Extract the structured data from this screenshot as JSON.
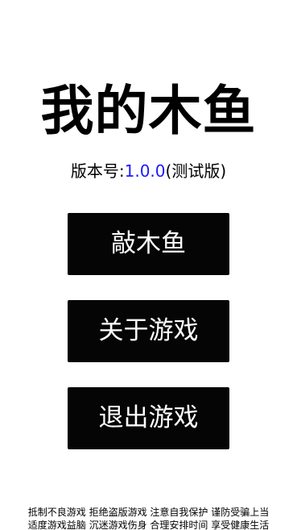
{
  "title": "我的木鱼",
  "version": {
    "label": "版本号:",
    "number": "1.0.0",
    "suffix": "(测试版)"
  },
  "menu": {
    "start_label": "敲木鱼",
    "about_label": "关于游戏",
    "exit_label": "退出游戏"
  },
  "health_notice": {
    "line1": "抵制不良游戏 拒绝盗版游戏 注意自我保护 谨防受骗上当",
    "line2": "适度游戏益脑 沉迷游戏伤身 合理安排时间 享受健康生活"
  },
  "colors": {
    "background": "#ffffff",
    "button": "#050505",
    "version_number": "#1a1aff"
  }
}
